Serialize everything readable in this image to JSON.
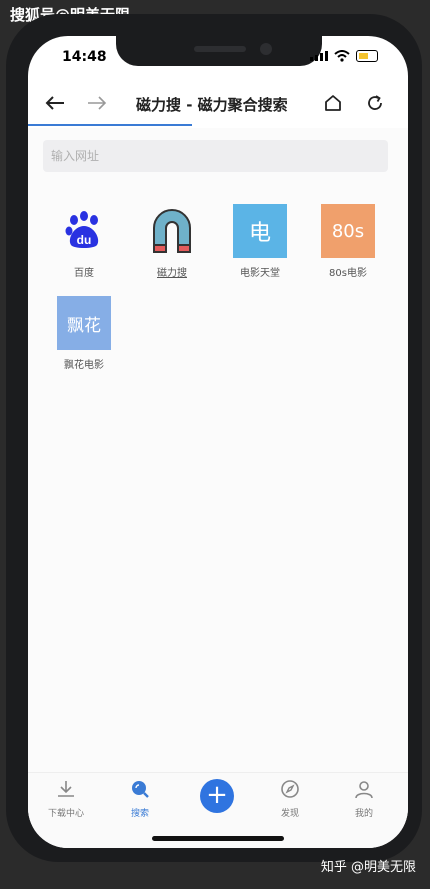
{
  "watermark": {
    "top": "搜狐号@明美无限",
    "bottom": "知乎 @明美无限"
  },
  "status": {
    "time": "14:48"
  },
  "nav": {
    "title": "磁力搜 - 磁力聚合搜索"
  },
  "address": {
    "placeholder": "输入网址"
  },
  "sites": [
    {
      "label": "百度",
      "tile_text": "du"
    },
    {
      "label": "磁力搜",
      "tile_text": ""
    },
    {
      "label": "电影天堂",
      "tile_text": "电"
    },
    {
      "label": "80s电影",
      "tile_text": "80s"
    },
    {
      "label": "飘花电影",
      "tile_text": "飘花"
    }
  ],
  "colors": {
    "accent": "#3a7bd5",
    "tile_dianying": "#5bb4e6",
    "tile_80s": "#f0a06c",
    "tile_piaohua": "#86aee6",
    "baidu_blue": "#2932e1"
  },
  "tabs": [
    {
      "label": "下载中心",
      "icon": "download-icon"
    },
    {
      "label": "搜索",
      "icon": "search-icon"
    },
    {
      "label": "",
      "icon": "plus-icon"
    },
    {
      "label": "发现",
      "icon": "compass-icon"
    },
    {
      "label": "我的",
      "icon": "user-icon"
    }
  ]
}
